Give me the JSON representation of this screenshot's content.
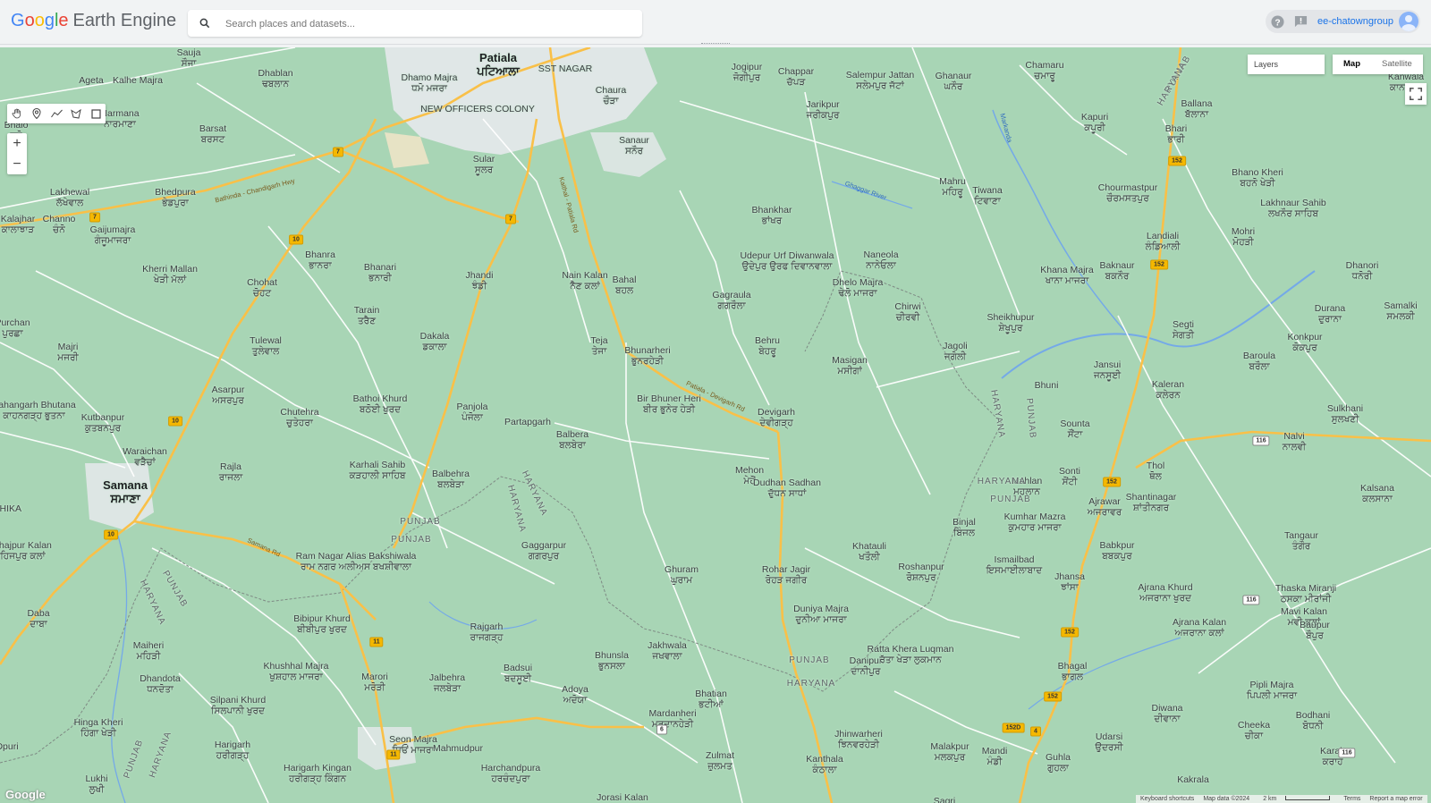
{
  "header": {
    "logo_google": [
      "G",
      "o",
      "o",
      "g",
      "l",
      "e"
    ],
    "logo_rest": "Earth Engine",
    "search_placeholder": "Search places and datasets...",
    "user": "ee-chatowngroup"
  },
  "map_controls": {
    "zoom_in": "+",
    "zoom_out": "−",
    "layers_label": "Layers",
    "map_type_options": [
      "Map",
      "Satellite"
    ],
    "map_type_selected": "Map",
    "watermark": "Google",
    "attribution": [
      "Keyboard shortcuts",
      "Map data ©2024",
      "2 km",
      "Terms",
      "Report a map error"
    ]
  },
  "colors": {
    "land": "#a8d5b5",
    "highway": "#f9c048",
    "road": "#ffffff",
    "urban": "#e8ebee",
    "water": "#74a9e8",
    "border": "#7e8a84"
  },
  "places": [
    {
      "name": "Patiala",
      "native": "ਪਟਿਆਲਾ",
      "big": true
    },
    {
      "name": "Sauja",
      "native": "ਸੌਜਾ"
    },
    {
      "name": "Dhablan",
      "native": "ਢਬਲਾਨ"
    },
    {
      "name": "Dhamo Majra",
      "native": "ਧਮੋ ਮਜਰਾ"
    },
    {
      "name": "SST NAGAR",
      "native": ""
    },
    {
      "name": "Ageta",
      "native": ""
    },
    {
      "name": "Kalhe Majra",
      "native": ""
    },
    {
      "name": "Jogipur",
      "native": "ਜੋਗੀਪੁਰ"
    },
    {
      "name": "Chappar",
      "native": "ਚੱਪੜ"
    },
    {
      "name": "Salempur Jattan",
      "native": "ਸਲੇਮਪੁਰ ਜੱਟਾਂ"
    },
    {
      "name": "Ghanaur",
      "native": "ਘਨੌਰ"
    },
    {
      "name": "Chamaru",
      "native": "ਚਮਾਰੂ"
    },
    {
      "name": "Kanwala",
      "native": "ਕਾਨਵਾਲਾ"
    },
    {
      "name": "Narmana",
      "native": "ਨਾਰਮਾਣਾ"
    },
    {
      "name": "Bhaio",
      "native": "ਭੜੋ"
    },
    {
      "name": "Barsat",
      "native": "ਬਰਸਟ"
    },
    {
      "name": "NEW OFFICERS COLONY",
      "native": ""
    },
    {
      "name": "Chaura",
      "native": "ਚੌੜਾ"
    },
    {
      "name": "Sanaur",
      "native": "ਸਨੌਰ"
    },
    {
      "name": "Jarikpur",
      "native": "ਜਰੀਕਪੁਰ"
    },
    {
      "name": "Kapuri",
      "native": "ਕਪੂਰੀ"
    },
    {
      "name": "Ballana",
      "native": "ਬੱਲਾਨਾ"
    },
    {
      "name": "Bhari",
      "native": "ਭਾਰੀ"
    },
    {
      "name": "Sular",
      "native": "ਸੂਲਰ"
    },
    {
      "name": "Lakhewal",
      "native": "ਲੱਖੇਵਾਲ"
    },
    {
      "name": "Bhedpura",
      "native": "ਭੇਡਪੁਰਾ"
    },
    {
      "name": "Mahru",
      "native": "ਮਹਿਰੂ"
    },
    {
      "name": "Tiwana",
      "native": "ਟਿਵਾਣਾ"
    },
    {
      "name": "Chourmastpur",
      "native": "ਚੌਰਮਸਤਪੁਰ"
    },
    {
      "name": "Bhano Kheri",
      "native": "ਬਹਨੋ ਖੇੜੀ"
    },
    {
      "name": "Kalajhar",
      "native": "ਕਾਲਾਝਾੜ"
    },
    {
      "name": "Channo",
      "native": "ਚੰਨੋ"
    },
    {
      "name": "Gaijumajra",
      "native": "ਗੰਜੂਮਾਜਰਾ"
    },
    {
      "name": "Bhankhar",
      "native": "ਭਾਂਖਰ"
    },
    {
      "name": "Lakhnaur Sahib",
      "native": "ਲਖਨੌਰ ਸਾਹਿਬ"
    },
    {
      "name": "Landiali",
      "native": "ਲੰਡਿਆਲੀ"
    },
    {
      "name": "Mohri",
      "native": "ਮੋਹੜੀ"
    },
    {
      "name": "Bhanra",
      "native": "ਭਾਨਰਾ"
    },
    {
      "name": "Bhanari",
      "native": "ਭਨਾਰੀ"
    },
    {
      "name": "Kherri Mallan",
      "native": "ਖੇੜੀ ਮੱਲਾਂ"
    },
    {
      "name": "Jhandi",
      "native": "ਝੰਡੀ"
    },
    {
      "name": "Nain Kalan",
      "native": "ਨੈਣ ਕਲਾਂ"
    },
    {
      "name": "Bahal",
      "native": "ਬਹਲ"
    },
    {
      "name": "Udepur Urf Diwanwala",
      "native": "ਉਦੇਪੁਰ ਉਰਫ ਦਿਵਾਨਵਾਲਾ"
    },
    {
      "name": "Naneola",
      "native": "ਨਾਨੇਓਲਾ"
    },
    {
      "name": "Baknaur",
      "native": "ਬਕਨੌਰ"
    },
    {
      "name": "Khana Majra",
      "native": "ਖਾਨਾ ਮਾਜਰਾ"
    },
    {
      "name": "Dhanori",
      "native": "ਧਨੋਰੀ"
    },
    {
      "name": "Chohat",
      "native": "ਚੋਹਟ"
    },
    {
      "name": "Gagraula",
      "native": "ਗਗਰੌਲਾ"
    },
    {
      "name": "Dhelo Majra",
      "native": "ਢੇਲੋ ਮਾਜਰਾ"
    },
    {
      "name": "Chirwi",
      "native": "ਚੀਰਵੀ"
    },
    {
      "name": "Samalki",
      "native": "ਸਮਲਕੀ"
    },
    {
      "name": "Durana",
      "native": "ਦੁਰਾਨਾ"
    },
    {
      "name": "Tarain",
      "native": "ਤਰੈਣ"
    },
    {
      "name": "Sheikhupur",
      "native": "ਸ਼ੇਖੂਪੁਰ"
    },
    {
      "name": "Segti",
      "native": "ਸੇਗਤੀ"
    },
    {
      "name": "Purchan",
      "native": "ਪੁਰਛਾ"
    },
    {
      "name": "Tulewal",
      "native": "ਤੁਲੇਵਾਲ"
    },
    {
      "name": "Dakala",
      "native": "ਡਕਾਲਾ"
    },
    {
      "name": "Teja",
      "native": "ਤੇਜਾ"
    },
    {
      "name": "Bhunarheri",
      "native": "ਭੁਨਰਹੇੜੀ"
    },
    {
      "name": "Behru",
      "native": "ਬੇਹਰੂ"
    },
    {
      "name": "Jagoli",
      "native": "ਜਗੋਲੀ"
    },
    {
      "name": "Konkpur",
      "native": "ਕੋਕਪੁਰ"
    },
    {
      "name": "Majri",
      "native": "ਮਜਰੀ"
    },
    {
      "name": "Masigan",
      "native": "ਮਸੀਗਾਂ"
    },
    {
      "name": "Baroula",
      "native": "ਬਰੌਲਾ"
    },
    {
      "name": "Jansui",
      "native": "ਜਨਸੂਈ"
    },
    {
      "name": "Asarpur",
      "native": "ਅਸਰਪੁਰ"
    },
    {
      "name": "Kaleran",
      "native": "ਕਲੇਰਨ"
    },
    {
      "name": "Bathoi Khurd",
      "native": "ਬਠੋਈ ਖੁਰਦ"
    },
    {
      "name": "Bir Bhuner Heri",
      "native": "ਬੀਰ ਭੁਨੇਰ ਹੇੜੀ"
    },
    {
      "name": "Bhuni",
      "native": ""
    },
    {
      "name": "Kahangarh Bhutana",
      "native": "ਕਾਹਨਗੜ੍ਹ ਭੁਤਨਾ"
    },
    {
      "name": "Chutehra",
      "native": "ਚੁਤੇਹਰਾ"
    },
    {
      "name": "Panjola",
      "native": "ਪੰਜੋਲਾ"
    },
    {
      "name": "Devigarh",
      "native": "ਦੇਵੀਗੜ੍ਹ"
    },
    {
      "name": "Sulkhani",
      "native": "ਸੁਲਖਣੀ"
    },
    {
      "name": "Kutbanpur",
      "native": "ਕੁਤਬਨਪੁਰ"
    },
    {
      "name": "Partapgarh",
      "native": ""
    },
    {
      "name": "Balbera",
      "native": "ਬਲਬੇਰਾ"
    },
    {
      "name": "Sounta",
      "native": "ਸੌਂਟਾ"
    },
    {
      "name": "Nalvi",
      "native": "ਨਾਲਵੀ"
    },
    {
      "name": "Waraichan",
      "native": "ਵੜੈਚਾਂ"
    },
    {
      "name": "Rajla",
      "native": "ਰਾਜਲਾ"
    },
    {
      "name": "Karhali Sahib",
      "native": "ਕੜਹਾਲੀ ਸਾਹਿਬ"
    },
    {
      "name": "Thol",
      "native": "ਥੋਲ"
    },
    {
      "name": "Samana",
      "native": "ਸਮਾਣਾ",
      "big": true
    },
    {
      "name": "Balbehra",
      "native": "ਬਲਬੇੜਾ"
    },
    {
      "name": "Mehon",
      "native": "ਮੇਹੋਂ"
    },
    {
      "name": "Dudhan Sadhan",
      "native": "ਦੁੱਧਨ ਸਾਧਾਂ"
    },
    {
      "name": "Sonti",
      "native": "ਸੋਂਟੀ"
    },
    {
      "name": "Mahlan",
      "native": "ਮਹਲਾਨ"
    },
    {
      "name": "Ajrawar",
      "native": "ਅਜਰਾਵਰ"
    },
    {
      "name": "Shantinagar",
      "native": "ਸ਼ਾਂਤੀਨਗਰ"
    },
    {
      "name": "Kalsana",
      "native": "ਕਲਸਾਨਾ"
    },
    {
      "name": "Sehajpur Kalan",
      "native": "ਸਹਿਜਪੁਰ ਕਲਾਂ"
    },
    {
      "name": "Ram Nagar Alias Bakshiwala",
      "native": "ਰਾਮ ਨਗਰ ਅਲੀਅਸ ਬਖਸ਼ੀਵਾਲਾ"
    },
    {
      "name": "Gaggarpur",
      "native": "ਗਗਰਪੁਰ"
    },
    {
      "name": "Binjal",
      "native": "ਬਿੰਜਲ"
    },
    {
      "name": "Kumhar Mazra",
      "native": "ਕੁਮਹਾਰ ਮਾਜਰਾ"
    },
    {
      "name": "Babkpur",
      "native": "ਬਬਕਪੁਰ"
    },
    {
      "name": "Tangaur",
      "native": "ਤੰਗੌਰ"
    },
    {
      "name": "Ghuram",
      "native": "ਘੁਰਾਮ"
    },
    {
      "name": "Rohar Jagir",
      "native": "ਰੋਹੜ ਜਗੀਰ"
    },
    {
      "name": "Khatauli",
      "native": "ਖਤੌਲੀ"
    },
    {
      "name": "Roshanpur",
      "native": "ਰੋਸ਼ਨਪੁਰ"
    },
    {
      "name": "Ismailbad",
      "native": "ਇਸਮਾਈਲਾਬਾਦ"
    },
    {
      "name": "Jhansa",
      "native": "ਝਾਂਸਾ"
    },
    {
      "name": "Ajrana Khurd",
      "native": "ਅਜਰਾਨਾ ਖੁਰਦ"
    },
    {
      "name": "Thaska Miranji",
      "native": "ਠਸਕਾ ਮੀਰਾਂਜੀ"
    },
    {
      "name": "Mavi Kalan",
      "native": "ਮਵੀ ਕਲਾਂ"
    },
    {
      "name": "Daba",
      "native": "ਦਾਬਾ"
    },
    {
      "name": "Bibipur Khurd",
      "native": "ਬੀਬੀਪੁਰ ਖੁਰਦ"
    },
    {
      "name": "Duniya Majra",
      "native": "ਦੁਨੀਆ ਮਾਜਰਾ"
    },
    {
      "name": "Ajrana Kalan",
      "native": "ਅਜਰਾਨਾ ਕਲਾਂ"
    },
    {
      "name": "Baupur",
      "native": "ਬੌਪੁਰ"
    },
    {
      "name": "Rajgarh",
      "native": "ਰਾਜਗੜ੍ਹ"
    },
    {
      "name": "Maiheri",
      "native": "ਮਹਿੜੀ"
    },
    {
      "name": "Bhunsla",
      "native": "ਭੁਨਸਲਾ"
    },
    {
      "name": "Jakhwala",
      "native": "ਜਖਵਾਲਾ"
    },
    {
      "name": "Danipur",
      "native": "ਦਾਨੀਪੁਰ"
    },
    {
      "name": "Ratta Khera Luqman",
      "native": "ਰੱਤਾ ਖੇੜਾ ਲੁਕਮਾਨ"
    },
    {
      "name": "Khushhal Majra",
      "native": "ਖੁਸ਼ਹਾਲ ਮਾਜਰਾ"
    },
    {
      "name": "Marori",
      "native": "ਮਰੋੜੀ"
    },
    {
      "name": "Dhandota",
      "native": "ਧਨਦੋਤਾ"
    },
    {
      "name": "Badsui",
      "native": "ਬਦਸੂਈ"
    },
    {
      "name": "Jalbehra",
      "native": "ਜਲਬੇੜਾ"
    },
    {
      "name": "Bhagal",
      "native": "ਭਾਗਲ"
    },
    {
      "name": "Adoya",
      "native": "ਅਦੋਯਾ"
    },
    {
      "name": "Bhatian",
      "native": "ਭਟੀਆਂ"
    },
    {
      "name": "Silpani Khurd",
      "native": "ਸਿਲਪਾਨੀ ਖੁਰਦ"
    },
    {
      "name": "Pipli Majra",
      "native": "ਪਿਪਲੀ ਮਾਜਰਾ"
    },
    {
      "name": "Diwana",
      "native": "ਦੀਵਾਨਾ"
    },
    {
      "name": "Mardanheri",
      "native": "ਮਰਦਾਨਹੇੜੀ"
    },
    {
      "name": "Hinga Kheri",
      "native": "ਹਿੰਗਾ ਖੇੜੀ"
    },
    {
      "name": "Bodhani",
      "native": "ਬੋਧਨੀ"
    },
    {
      "name": "Jhinwarheri",
      "native": "ਝਿਨਵਰਹੇੜੀ"
    },
    {
      "name": "Cheeka",
      "native": "ਚੀਕਾ"
    },
    {
      "name": "Seon Majra",
      "native": "ਸਿਓਂ ਮਾਜਰਾ"
    },
    {
      "name": "Harigarh",
      "native": "ਹਰੀਗੜ੍ਹ"
    },
    {
      "name": "Malakpur",
      "native": "ਮਲਕਪੁਰ"
    },
    {
      "name": "Mandi",
      "native": "ਮੰਡੀ"
    },
    {
      "name": "Udarsi",
      "native": "ਉਦਰਸੀ"
    },
    {
      "name": "Karah",
      "native": "ਕਰਾਹ"
    },
    {
      "name": "Zulmat",
      "native": "ਜ਼ੁਲਮਤ"
    },
    {
      "name": "Kanthala",
      "native": "ਕੰਠਾਲਾ"
    },
    {
      "name": "Guhla",
      "native": "ਗੁਹਲਾ"
    },
    {
      "name": "Harigarh Kingan",
      "native": "ਹਰੀਗੜ੍ਹ ਕਿੰਗਨ"
    },
    {
      "name": "Harchandpura",
      "native": "ਹਰਚੰਦਪੁਰਾ"
    },
    {
      "name": "Lukhi",
      "native": "ਲੁਖੀ"
    },
    {
      "name": "Kakrala",
      "native": ""
    },
    {
      "name": "Jorasi Kalan",
      "native": ""
    },
    {
      "name": "Sagri",
      "native": ""
    },
    {
      "name": "Dpuri",
      "native": ""
    },
    {
      "name": "CHIKA",
      "native": ""
    },
    {
      "name": "Mahmudpur",
      "native": ""
    }
  ],
  "state_labels": [
    "PUNJAB",
    "HARYANA",
    "HARYANA",
    "PUNJAB",
    "PUNJAB",
    "HARYANA",
    "HARYANA",
    "PUNJAB",
    "PUNJAB",
    "HARYANA",
    "HARYANA",
    "PUNJAB",
    "PUNJAB",
    "HARYANA",
    "HARYANA",
    "PUNJAB"
  ],
  "road_shields": [
    "7",
    "7",
    "7",
    "10",
    "10",
    "10",
    "11",
    "11",
    "152",
    "152",
    "152",
    "152",
    "152",
    "152D",
    "4",
    "116",
    "116",
    "116",
    "6"
  ],
  "road_names": [
    "Bathinda - Chandigarh Hwy",
    "Kaithal - Patiala Rd",
    "Patiala - Devigarh Rd",
    "Samana Rd"
  ],
  "water_names": [
    "Ghaggar River",
    "Markanda"
  ]
}
